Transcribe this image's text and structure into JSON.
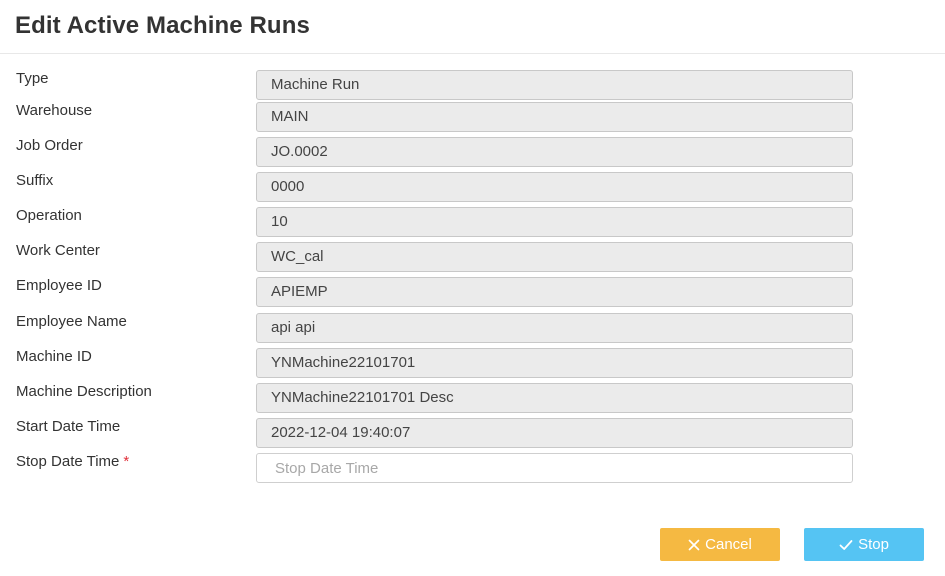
{
  "dialog": {
    "title": "Edit Active Machine Runs"
  },
  "fields": [
    {
      "label": "Type",
      "value": "Machine Run"
    },
    {
      "label": "Warehouse",
      "value": "MAIN"
    },
    {
      "label": "Job Order",
      "value": "JO.0002"
    },
    {
      "label": "Suffix",
      "value": "0000"
    },
    {
      "label": "Operation",
      "value": "10"
    },
    {
      "label": "Work Center",
      "value": "WC_cal"
    },
    {
      "label": "Employee ID",
      "value": "APIEMP"
    },
    {
      "label": "Employee Name",
      "value": "api api"
    },
    {
      "label": "Machine ID",
      "value": "YNMachine22101701"
    },
    {
      "label": "Machine Description",
      "value": "YNMachine22101701 Desc"
    },
    {
      "label": "Start Date Time",
      "value": "2022-12-04 19:40:07"
    }
  ],
  "stop_field": {
    "label": "Stop Date Time",
    "required_marker": "*",
    "value": "",
    "placeholder": "Stop Date Time"
  },
  "buttons": {
    "cancel_label": "Cancel",
    "cancel_icon": "close-icon",
    "cancel_color": "#f5b942",
    "stop_label": "Stop",
    "stop_icon": "check-icon",
    "stop_color": "#55c4f3"
  },
  "colors": {
    "readonly_field_bg": "#ebebeb",
    "required": "#e0303a"
  }
}
